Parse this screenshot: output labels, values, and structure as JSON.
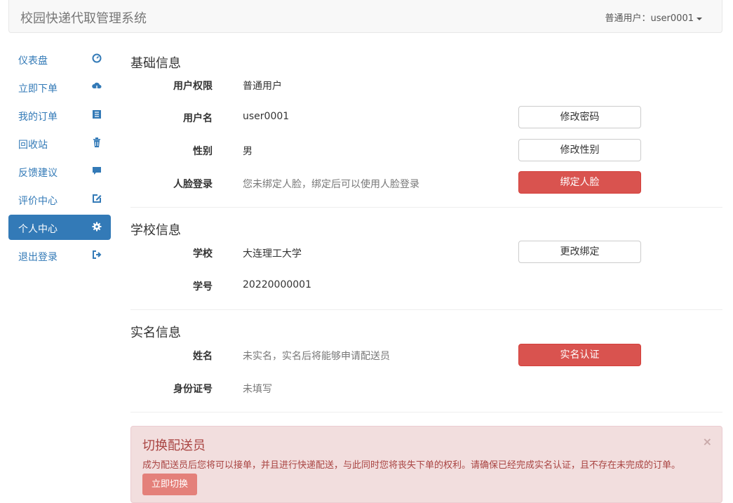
{
  "app": {
    "title": "校园快递代取管理系统"
  },
  "user_menu": {
    "label": "普通用户：user0001"
  },
  "sidebar": {
    "items": [
      {
        "label": "仪表盘",
        "icon": "dashboard-icon"
      },
      {
        "label": "立即下单",
        "icon": "cloud-download-icon"
      },
      {
        "label": "我的订单",
        "icon": "list-icon"
      },
      {
        "label": "回收站",
        "icon": "trash-icon"
      },
      {
        "label": "反馈建议",
        "icon": "comment-icon"
      },
      {
        "label": "评价中心",
        "icon": "edit-icon"
      },
      {
        "label": "个人中心",
        "icon": "gear-icon",
        "active": true
      },
      {
        "label": "退出登录",
        "icon": "logout-icon"
      }
    ]
  },
  "basic": {
    "title": "基础信息",
    "permission_label": "用户权限",
    "permission_value": "普通用户",
    "username_label": "用户名",
    "username_value": "user0001",
    "gender_label": "性别",
    "gender_value": "男",
    "face_label": "人脸登录",
    "face_value": "您未绑定人脸，绑定后可以使用人脸登录",
    "change_password": "修改密码",
    "change_gender": "修改性别",
    "bind_face": "绑定人脸"
  },
  "school": {
    "title": "学校信息",
    "school_label": "学校",
    "school_value": "大连理工大学",
    "student_id_label": "学号",
    "student_id_value": "20220000001",
    "change_binding": "更改绑定"
  },
  "realname": {
    "title": "实名信息",
    "name_label": "姓名",
    "name_value": "未实名，实名后将能够申请配送员",
    "id_label": "身份证号",
    "id_value": "未填写",
    "verify_button": "实名认证"
  },
  "alert": {
    "title": "切换配送员",
    "text": "成为配送员后您将可以接单，并且进行快递配送，与此同时您将丧失下单的权利。请确保已经完成实名认证，且不存在未完成的订单。",
    "button": "立即切换",
    "close": "×"
  },
  "colors": {
    "primary": "#337ab7",
    "danger": "#d9534f",
    "alert_bg": "#f2dede",
    "alert_text": "#a94442"
  }
}
